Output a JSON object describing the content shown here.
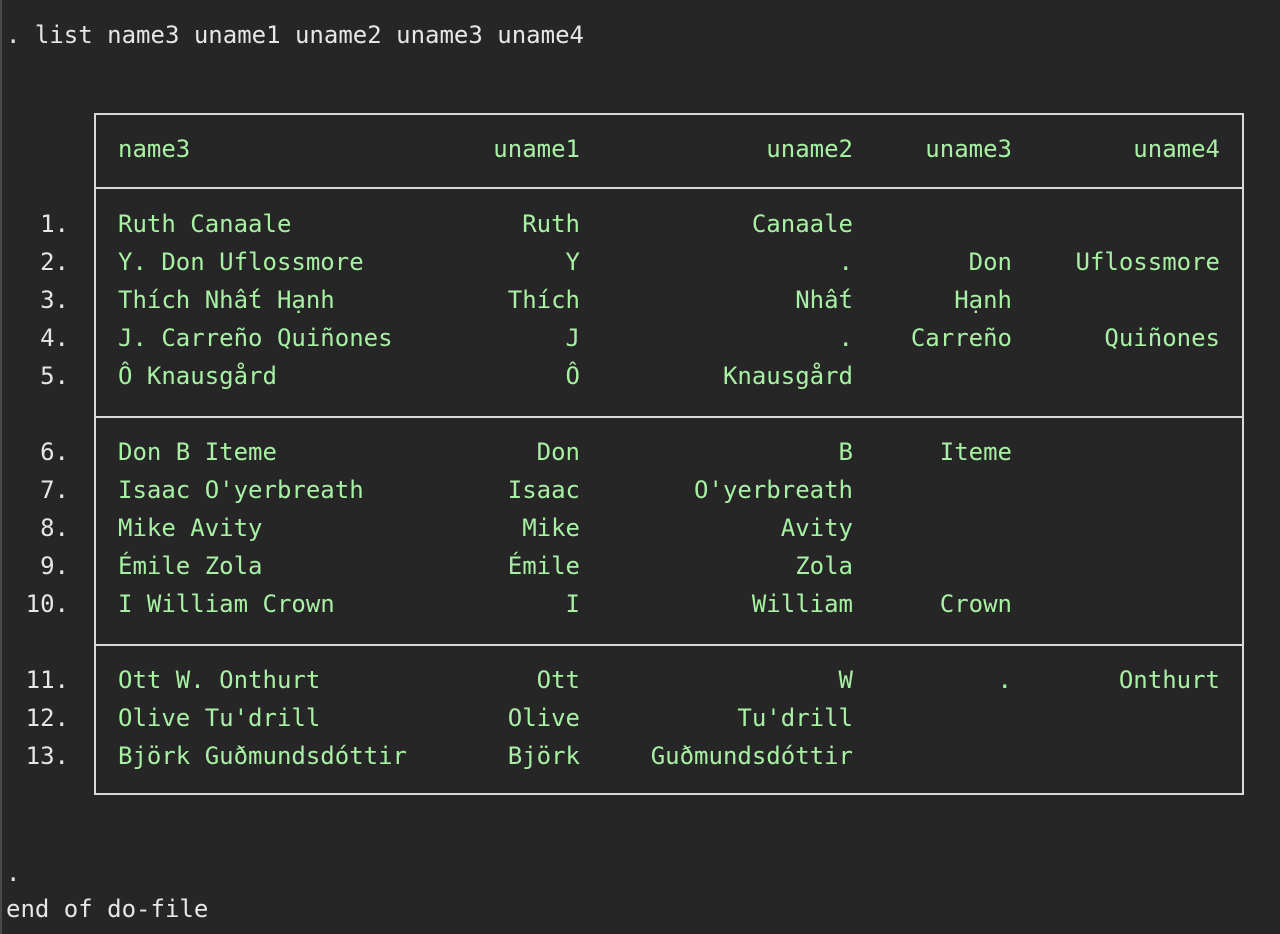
{
  "console": {
    "command": ". list name3 uname1 uname2 uname3 uname4",
    "end_dot": ".",
    "end_text": "end of do-file"
  },
  "table": {
    "headers": [
      "name3",
      "uname1",
      "uname2",
      "uname3",
      "uname4"
    ],
    "rows": [
      {
        "n": "1.",
        "name3": "Ruth Canaale",
        "uname1": "Ruth",
        "uname2": "Canaale",
        "uname3": "",
        "uname4": ""
      },
      {
        "n": "2.",
        "name3": "Y. Don Uflossmore",
        "uname1": "Y",
        "uname2": ".",
        "uname3": "Don",
        "uname4": "Uflossmore"
      },
      {
        "n": "3.",
        "name3": "Thích Nhất Hạnh",
        "uname1": "Thích",
        "uname2": "Nhất",
        "uname3": "Hạnh",
        "uname4": ""
      },
      {
        "n": "4.",
        "name3": "J. Carreño Quiñones",
        "uname1": "J",
        "uname2": ".",
        "uname3": "Carreño",
        "uname4": "Quiñones"
      },
      {
        "n": "5.",
        "name3": "Ô Knausgård",
        "uname1": "Ô",
        "uname2": "Knausgård",
        "uname3": "",
        "uname4": ""
      },
      {
        "n": "6.",
        "name3": "Don B Iteme",
        "uname1": "Don",
        "uname2": "B",
        "uname3": "Iteme",
        "uname4": ""
      },
      {
        "n": "7.",
        "name3": "Isaac O'yerbreath",
        "uname1": "Isaac",
        "uname2": "O'yerbreath",
        "uname3": "",
        "uname4": ""
      },
      {
        "n": "8.",
        "name3": "Mike Avity",
        "uname1": "Mike",
        "uname2": "Avity",
        "uname3": "",
        "uname4": ""
      },
      {
        "n": "9.",
        "name3": "Émile Zola",
        "uname1": "Émile",
        "uname2": "Zola",
        "uname3": "",
        "uname4": ""
      },
      {
        "n": "10.",
        "name3": "I William Crown",
        "uname1": "I",
        "uname2": "William",
        "uname3": "Crown",
        "uname4": ""
      },
      {
        "n": "11.",
        "name3": "Ott W. Onthurt",
        "uname1": "Ott",
        "uname2": "W",
        "uname3": ".",
        "uname4": "Onthurt"
      },
      {
        "n": "12.",
        "name3": "Olive Tu'drill",
        "uname1": "Olive",
        "uname2": "Tu'drill",
        "uname3": "",
        "uname4": ""
      },
      {
        "n": "13.",
        "name3": "Björk Guðmundsdóttir",
        "uname1": "Björk",
        "uname2": "Guðmundsdóttir",
        "uname3": "",
        "uname4": ""
      }
    ]
  },
  "colors": {
    "background": "#262626",
    "table_text": "#a8f0a4",
    "console_text": "#e6e6e6",
    "border": "#d9d9d9"
  }
}
